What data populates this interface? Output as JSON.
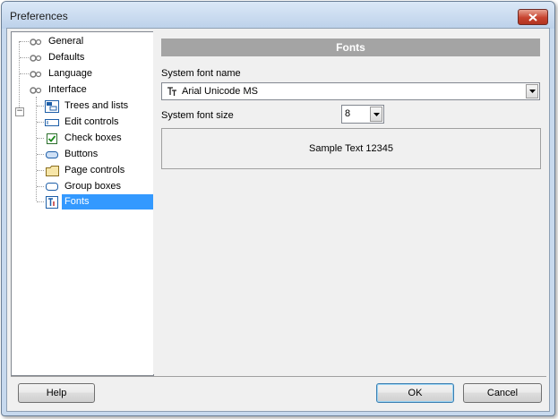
{
  "window": {
    "title": "Preferences"
  },
  "tree": {
    "items": [
      {
        "label": "General",
        "icon": "settings-icon"
      },
      {
        "label": "Defaults",
        "icon": "settings-icon"
      },
      {
        "label": "Language",
        "icon": "settings-icon"
      },
      {
        "label": "Interface",
        "icon": "settings-icon",
        "expanded": true
      },
      {
        "label": "Trees and lists",
        "icon": "tree-list-icon"
      },
      {
        "label": "Edit controls",
        "icon": "edit-control-icon"
      },
      {
        "label": "Check boxes",
        "icon": "checkbox-icon"
      },
      {
        "label": "Buttons",
        "icon": "button-icon"
      },
      {
        "label": "Page controls",
        "icon": "folder-tab-icon"
      },
      {
        "label": "Group boxes",
        "icon": "group-box-icon"
      },
      {
        "label": "Fonts",
        "icon": "font-icon",
        "selected": true
      }
    ]
  },
  "panel": {
    "header": "Fonts",
    "font_name_label": "System font name",
    "font_name_value": "Arial Unicode MS",
    "font_size_label": "System font size",
    "font_size_value": "8",
    "sample_text": "Sample Text 12345"
  },
  "buttons": {
    "help": "Help",
    "ok": "OK",
    "cancel": "Cancel"
  },
  "colors": {
    "selection": "#3399ff",
    "header_bar": "#a4a4a4",
    "close_button": "#c7432f",
    "title_bar": "#c7d9ee"
  }
}
